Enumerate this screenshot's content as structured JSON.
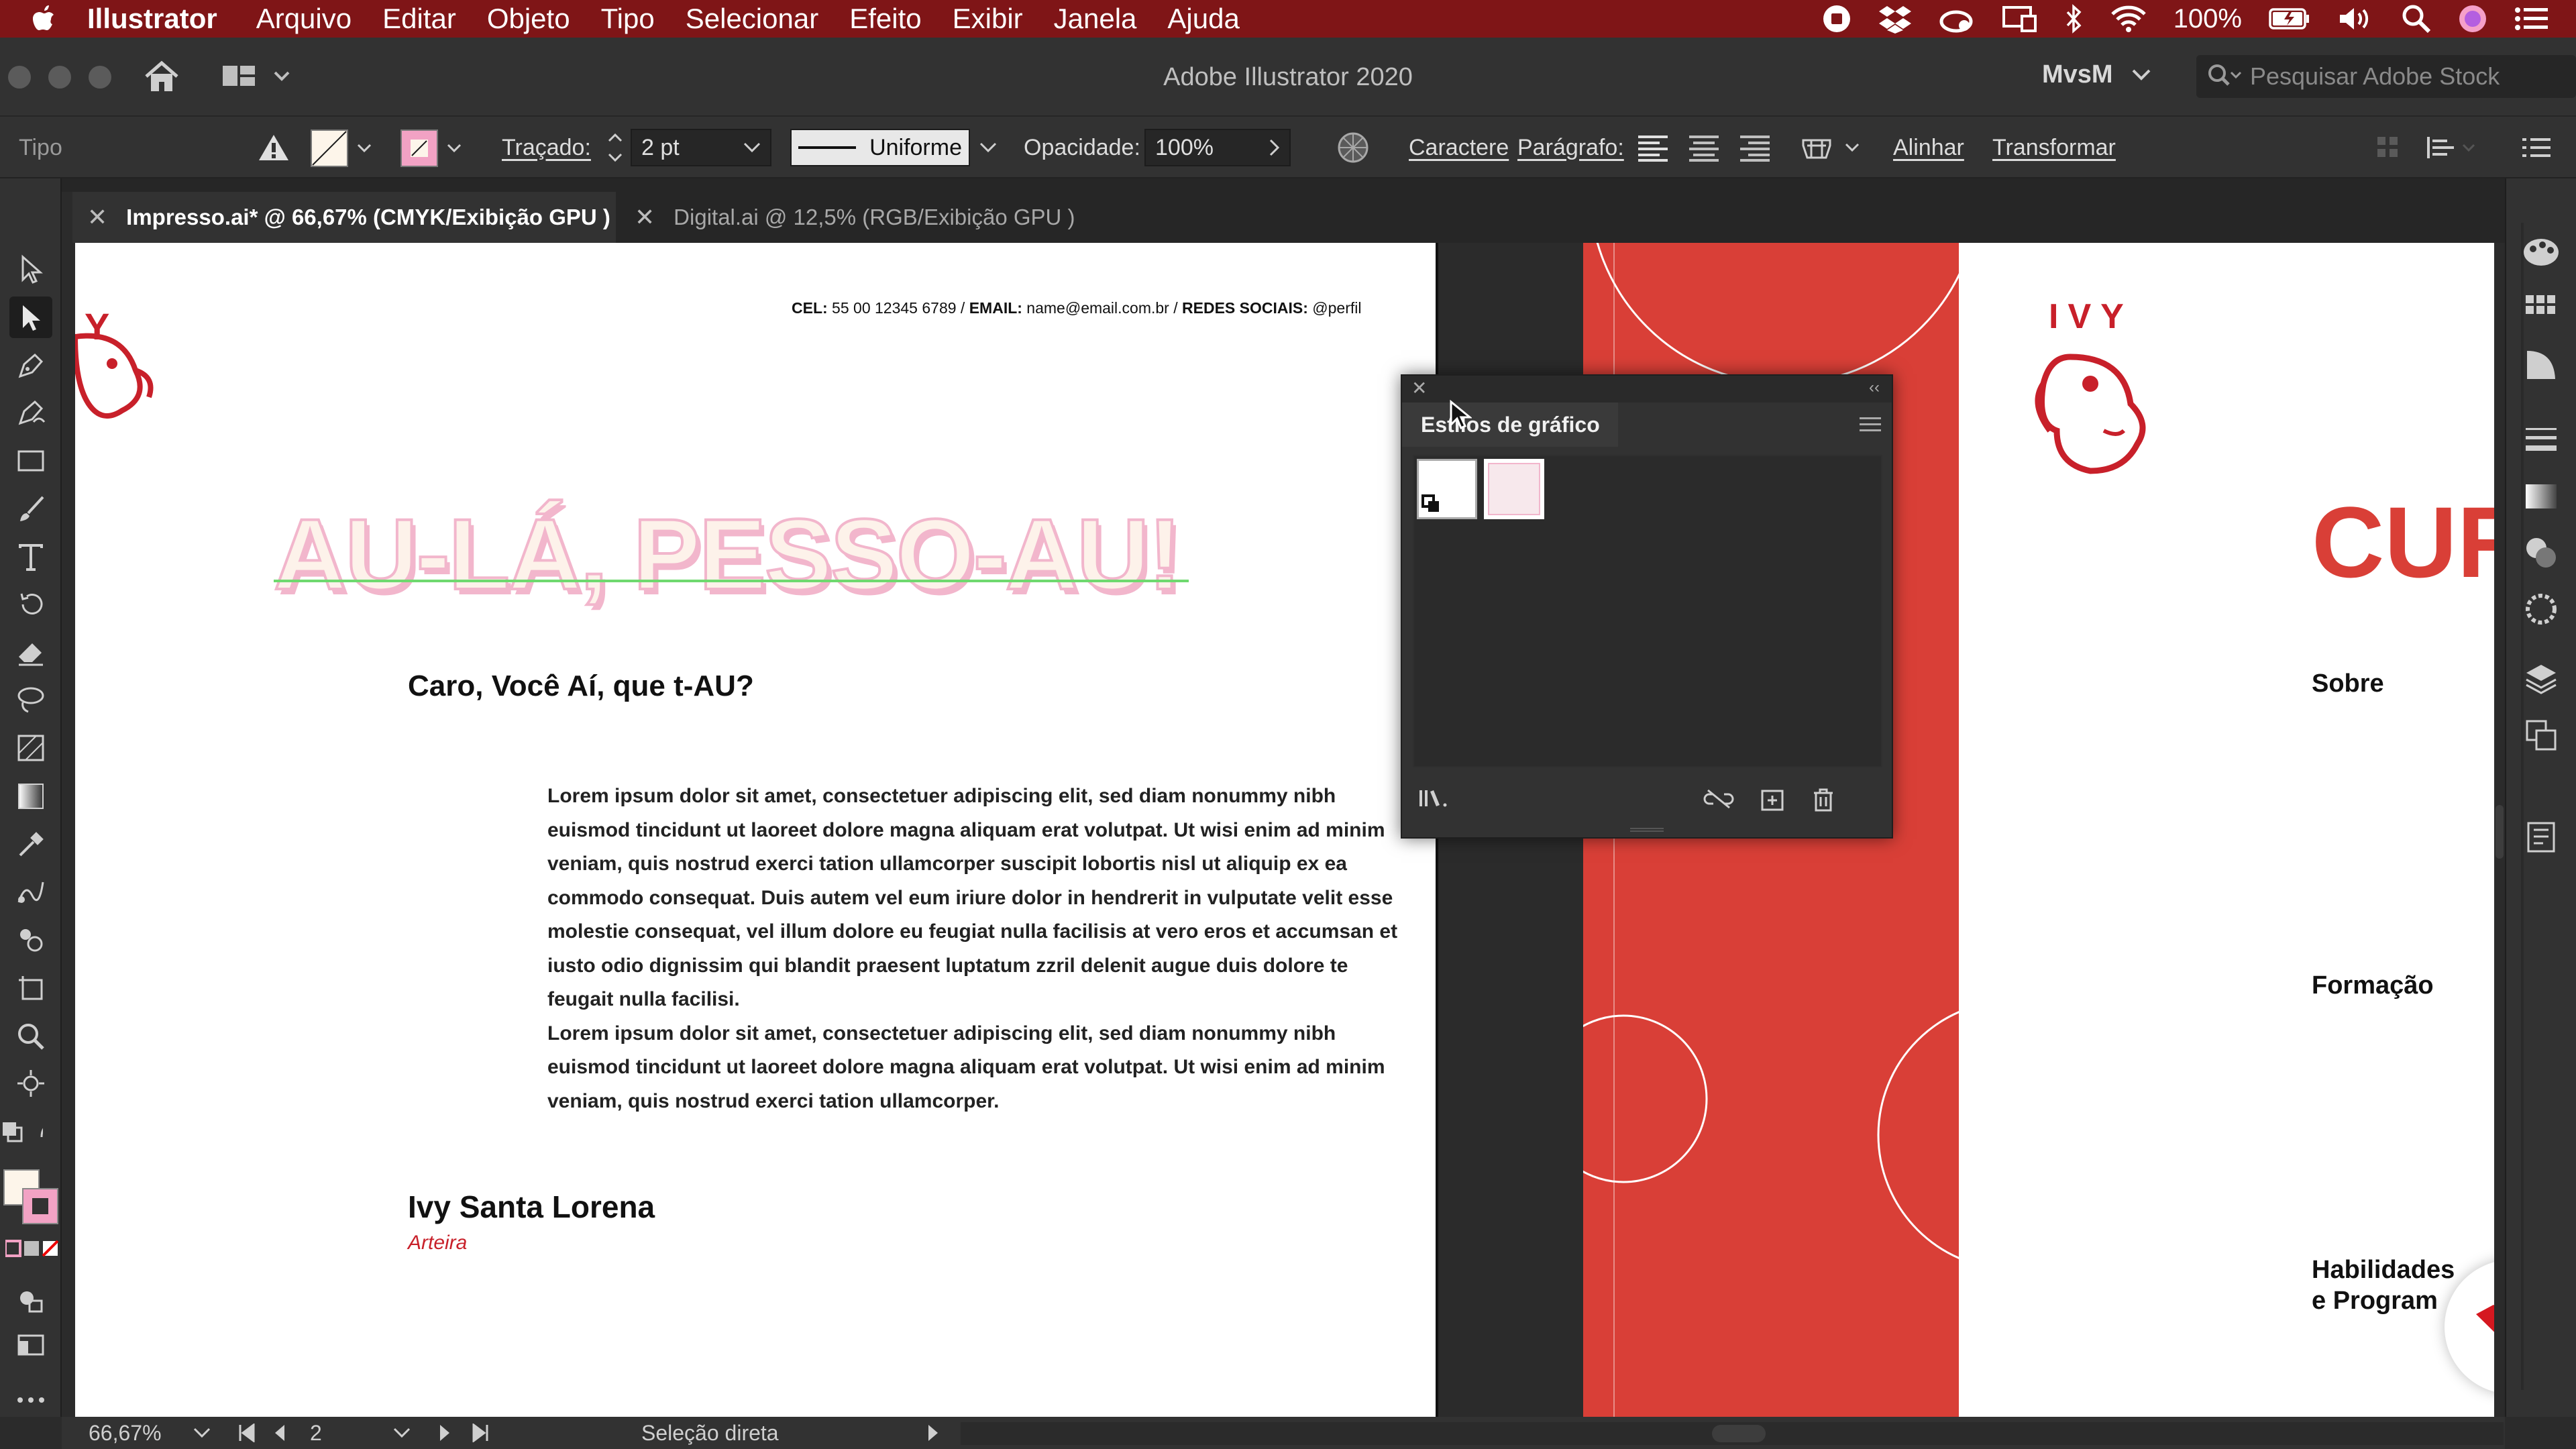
{
  "menubar": {
    "app_name": "Illustrator",
    "items": [
      "Arquivo",
      "Editar",
      "Objeto",
      "Tipo",
      "Selecionar",
      "Efeito",
      "Exibir",
      "Janela",
      "Ajuda"
    ],
    "battery_text": "100%"
  },
  "titlebar": {
    "title": "Adobe Illustrator 2020",
    "workspace": "MvsM",
    "search_placeholder": "Pesquisar Adobe Stock"
  },
  "controlbar": {
    "context_label": "Tipo",
    "stroke_label": "Traçado:",
    "stroke_value": "2 pt",
    "profile_value": "Uniforme",
    "opacity_label": "Opacidade:",
    "opacity_value": "100%",
    "character_label": "Caractere",
    "paragraph_label": "Parágrafo:",
    "align_label": "Alinhar",
    "transform_label": "Transformar"
  },
  "tabs": [
    {
      "label": "Impresso.ai* @ 66,67% (CMYK/Exibição GPU )"
    },
    {
      "label": "Digital.ai @ 12,5% (RGB/Exibição GPU )"
    }
  ],
  "artboard1": {
    "logo_text": "Y",
    "contact": {
      "cel_label": "CEL:",
      "cel_value": " 55 00 12345 6789 / ",
      "email_label": "EMAIL:",
      "email_value": " name@email.com.br / ",
      "social_label": "REDES SOCIAIS:",
      "social_value": " @perfil"
    },
    "headline": "AU-LÁ, PESSO-AU!",
    "greeting": "Caro, Você Aí, que t-AU?",
    "paragraph1": "Lorem ipsum dolor sit amet, consectetuer adipiscing elit, sed diam nonummy nibh euismod tincidunt ut laoreet dolore magna aliquam erat volutpat. Ut wisi enim ad minim veniam, quis nostrud exerci tation ullamcorper suscipit lobortis nisl ut aliquip ex ea commodo consequat. Duis autem vel eum iriure dolor in hendrerit in vulputate velit esse molestie consequat, vel illum dolore eu feugiat nulla facilisis at vero eros et accumsan et iusto odio dignissim qui blandit praesent luptatum zzril delenit augue duis dolore te feugait nulla facilisi.",
    "paragraph2": "Lorem ipsum dolor sit amet, consectetuer adipiscing elit, sed diam nonummy nibh euismod tincidunt ut laoreet dolore magna aliquam erat volutpat. Ut wisi enim ad minim veniam, quis nostrud exerci tation ullamcorper.",
    "name": "Ivy Santa Lorena",
    "role": "Arteira"
  },
  "artboard2": {
    "logo_text": "IVY",
    "title_partial": "CUR",
    "sections": [
      "Sobre",
      "Formação",
      "Habilidades",
      "e Program"
    ]
  },
  "graphic_styles_panel": {
    "title": "Estilos de gráfico"
  },
  "statusbar": {
    "zoom": "66,67%",
    "artboard_number": "2",
    "tool_status": "Seleção direta"
  },
  "colors": {
    "menubar_bg": "#7f1517",
    "brand_red": "#d93f37",
    "headline_pink": "#f2b6cc",
    "role_red": "#c8202a"
  }
}
